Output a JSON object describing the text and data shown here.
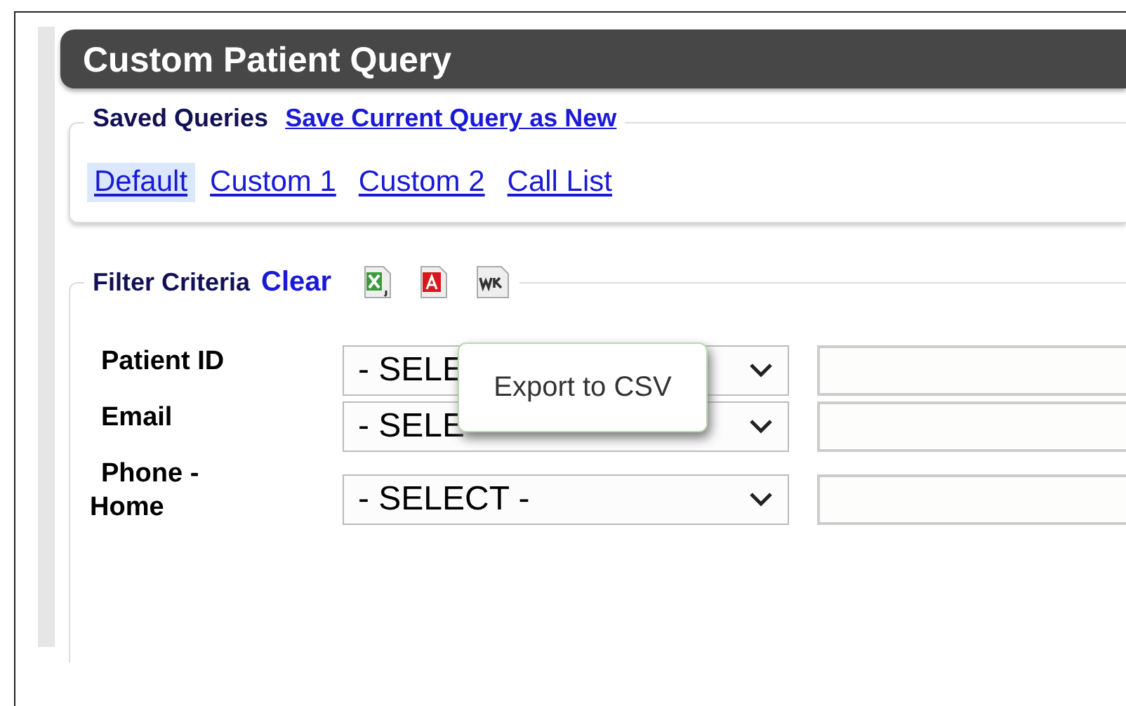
{
  "panel": {
    "title": "Custom Patient Query"
  },
  "saved_queries": {
    "legend": "Saved Queries",
    "save_link": "Save Current Query as New",
    "queries": [
      {
        "label": "Default",
        "selected": true
      },
      {
        "label": "Custom 1",
        "selected": false
      },
      {
        "label": "Custom 2",
        "selected": false
      },
      {
        "label": "Call List",
        "selected": false
      }
    ]
  },
  "filter": {
    "legend": "Filter Criteria",
    "clear_link": "Clear",
    "export_buttons": [
      {
        "kind": "excel"
      },
      {
        "kind": "pdf"
      },
      {
        "kind": "wk"
      }
    ],
    "tooltip": "Export to CSV",
    "rows": [
      {
        "label": "Patient ID",
        "select": "- SELE"
      },
      {
        "label": "Email",
        "select": "- SELE"
      },
      {
        "label": "Phone - Home",
        "select": "- SELECT -"
      }
    ]
  }
}
